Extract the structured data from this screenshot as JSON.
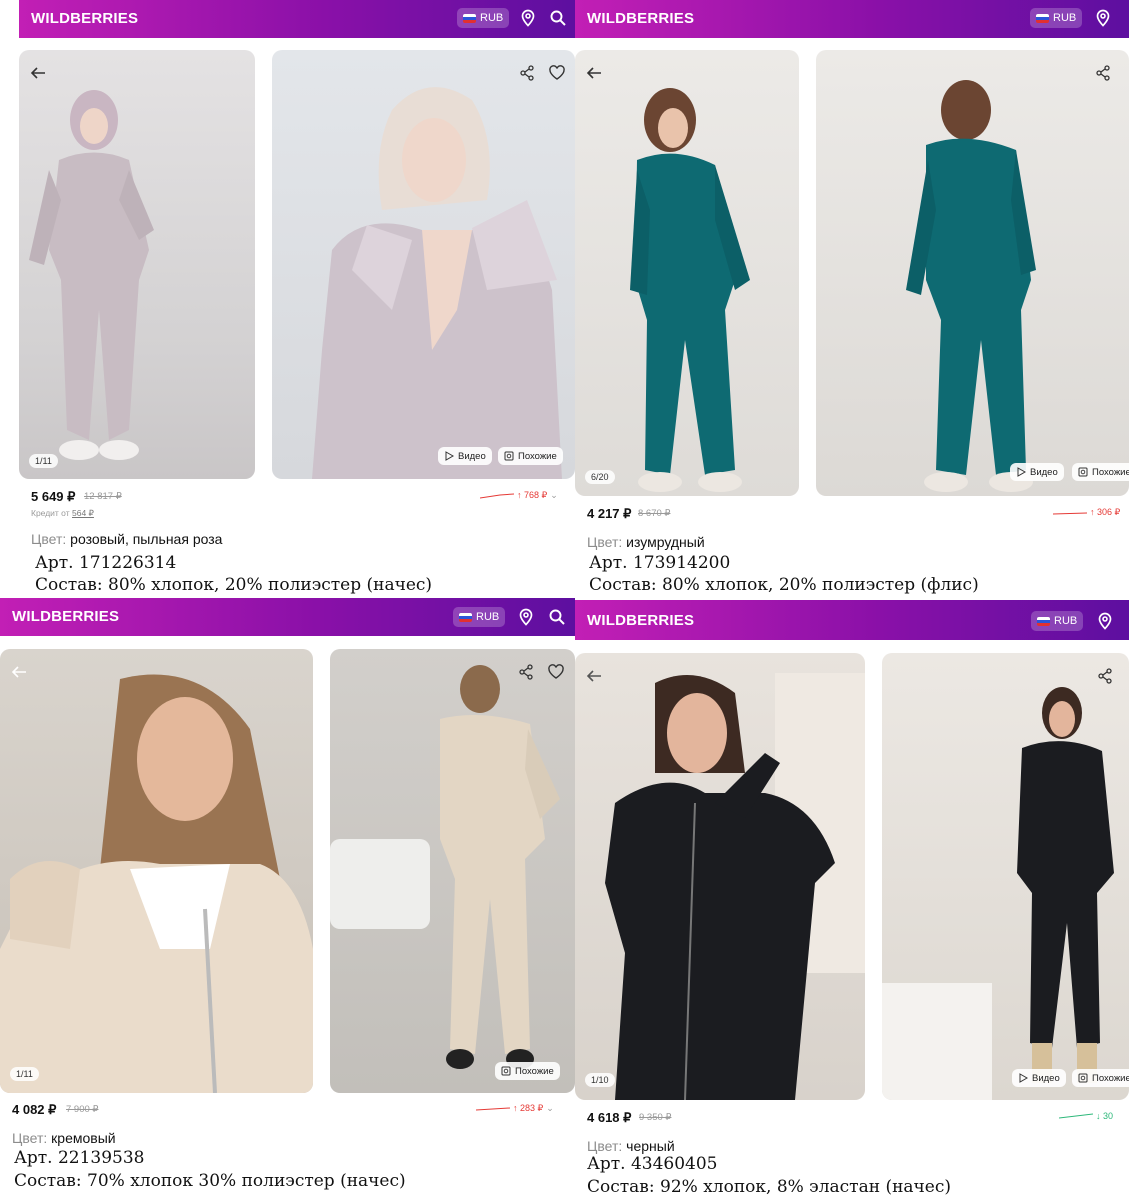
{
  "brand": "WILDBERRIES",
  "currency": "RUB",
  "colors": {
    "header_start": "#c21fb5",
    "header_end": "#5d0fa0",
    "up_trend": "#e53935",
    "down_trend": "#2db87a"
  },
  "labels": {
    "video": "Видео",
    "similar": "Похожие",
    "color_prefix": "Цвет:",
    "credit_prefix": "Кредит от"
  },
  "panels": [
    {
      "counter": "1/11",
      "price": "5 649 ₽",
      "old_price": "12 817 ₽",
      "credit_value": "564 ₽",
      "trend": "↑ 768 ₽",
      "trend_dir": "up",
      "color": "розовый, пыльная роза",
      "article": "Арт. 171226314",
      "composition": "Состав: 80% хлопок, 20% полиэстер (начес)"
    },
    {
      "counter": "6/20",
      "price": "4 217 ₽",
      "old_price": "8 670 ₽",
      "trend": "↑ 306 ₽",
      "trend_dir": "up",
      "color": "изумрудный",
      "article": "Арт. 173914200",
      "composition": "Состав: 80% хлопок, 20% полиэстер (флис)"
    },
    {
      "counter": "1/11",
      "price": "4 082 ₽",
      "old_price": "7 900 ₽",
      "trend": "↑ 283 ₽",
      "trend_dir": "up",
      "color": "кремовый",
      "article": "Арт. 22139538",
      "composition": "Состав: 70% хлопок 30% полиэстер (начес)"
    },
    {
      "counter": "1/10",
      "price": "4 618 ₽",
      "old_price": "9 350 ₽",
      "trend": "↓ 30",
      "trend_dir": "down",
      "color": "черный",
      "article": "Арт. 43460405",
      "composition": "Состав: 92% хлопок, 8% эластан (начес)"
    }
  ]
}
